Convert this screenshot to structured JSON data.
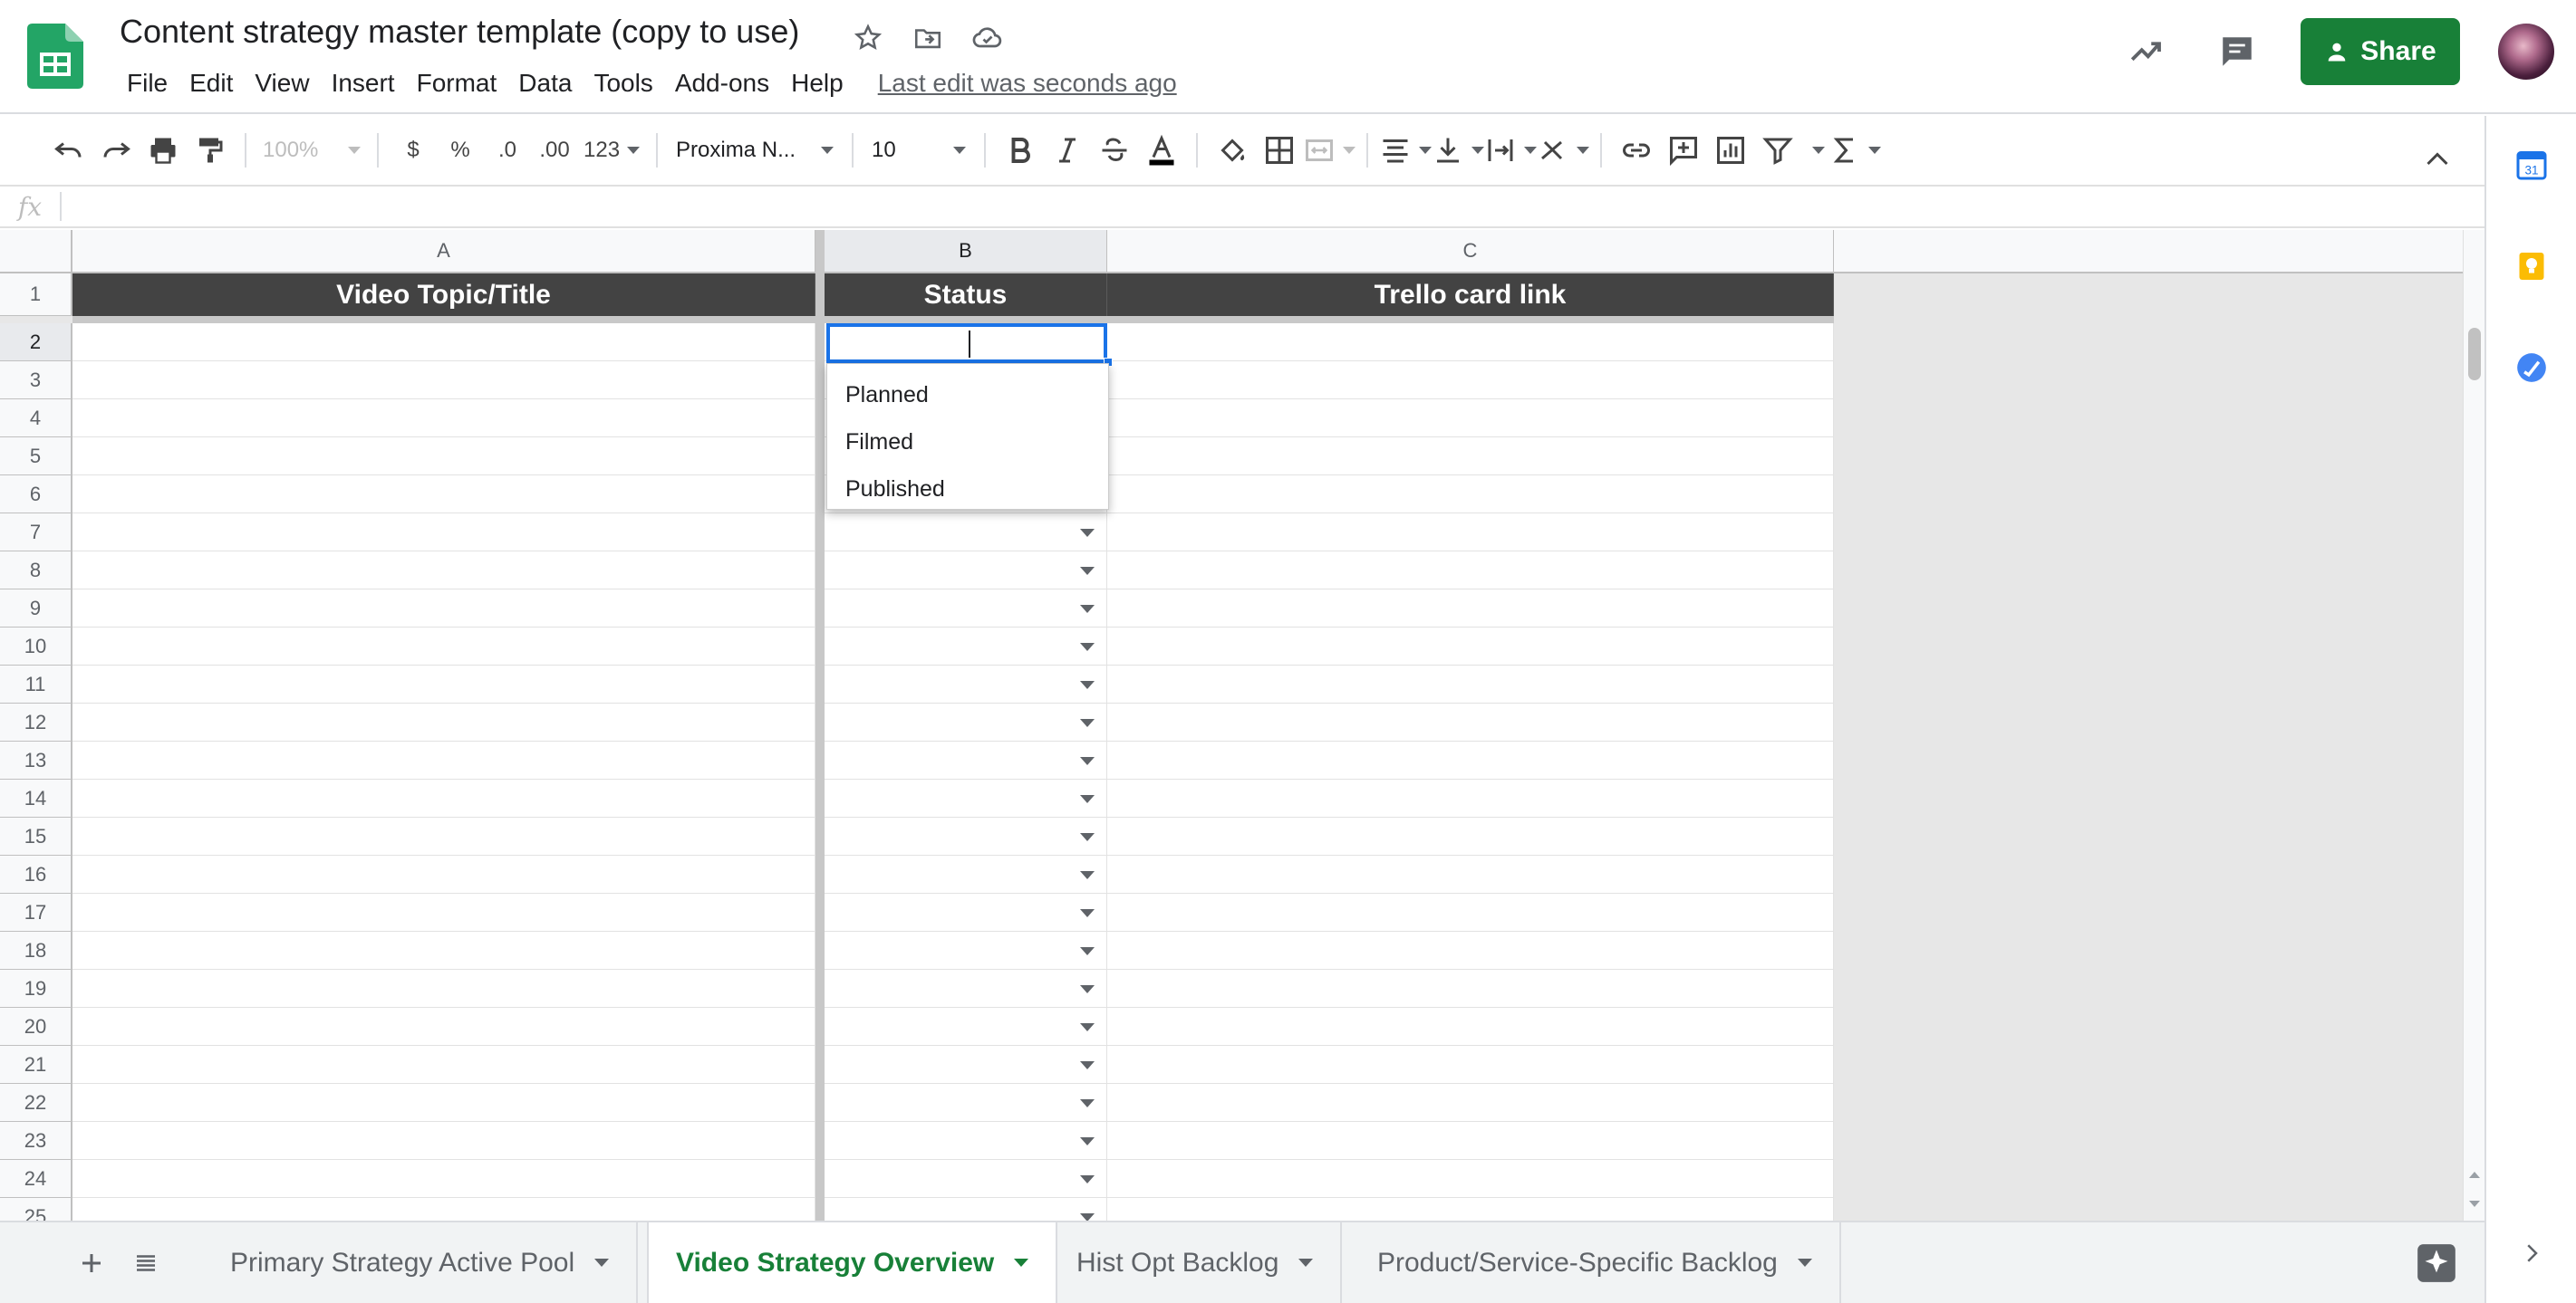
{
  "document": {
    "title": "Content strategy master template (copy to use)",
    "last_edit": "Last edit was seconds ago"
  },
  "menu": [
    "File",
    "Edit",
    "View",
    "Insert",
    "Format",
    "Data",
    "Tools",
    "Add-ons",
    "Help"
  ],
  "header": {
    "share_label": "Share"
  },
  "toolbar": {
    "zoom": "100%",
    "currency": "$",
    "percent": "%",
    "dec_decrease": ".0",
    "dec_increase": ".00",
    "more_formats": "123",
    "font": "Proxima N...",
    "font_size": "10"
  },
  "formula_bar": {
    "fx_label": "fx",
    "value": ""
  },
  "columns": [
    "A",
    "B",
    "C"
  ],
  "header_row": [
    "Video Topic/Title",
    "Status",
    "Trello card link"
  ],
  "row_numbers": [
    "1",
    "2",
    "3",
    "4",
    "5",
    "6",
    "7",
    "8",
    "9",
    "10",
    "11",
    "12",
    "13",
    "14",
    "15",
    "16",
    "17",
    "18",
    "19",
    "20",
    "21",
    "22",
    "23",
    "24",
    "25"
  ],
  "active_cell": {
    "ref": "B2",
    "value": ""
  },
  "status_dropdown": {
    "options": [
      "Planned",
      "Filmed",
      "Published"
    ]
  },
  "sheets": [
    {
      "name": "Primary Strategy Active Pool",
      "active": false
    },
    {
      "name": "Video Strategy Overview",
      "active": true
    },
    {
      "name": "Hist Opt Backlog",
      "active": false
    },
    {
      "name": "Product/Service-Specific Backlog",
      "active": false
    }
  ],
  "side_panel": {
    "calendar_day": "31"
  },
  "colors": {
    "brand_green": "#188038",
    "header_fill": "#434343",
    "selection_blue": "#1a73e8"
  }
}
